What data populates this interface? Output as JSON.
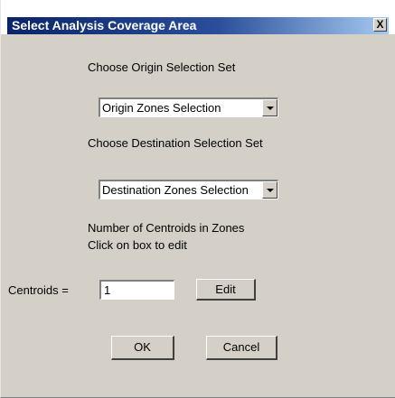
{
  "dialog": {
    "title": "Select Analysis Coverage Area",
    "close_glyph": "X"
  },
  "origin": {
    "heading": "Choose Origin Selection Set",
    "selected": "Origin Zones Selection"
  },
  "destination": {
    "heading": "Choose Destination Selection Set",
    "selected": "Destination Zones Selection"
  },
  "centroids": {
    "note_line1": "Number of Centroids in Zones",
    "note_line2": "Click on box to edit",
    "label": "Centroids =",
    "value": "1",
    "edit_label": "Edit"
  },
  "buttons": {
    "ok_label": "OK",
    "cancel_label": "Cancel"
  },
  "colors": {
    "title_start": "#0a246a",
    "title_end": "#a6caf0",
    "face": "#d4d0c8"
  },
  "icons": {
    "close": "close-icon",
    "dropdown": "chevron-down-icon"
  }
}
